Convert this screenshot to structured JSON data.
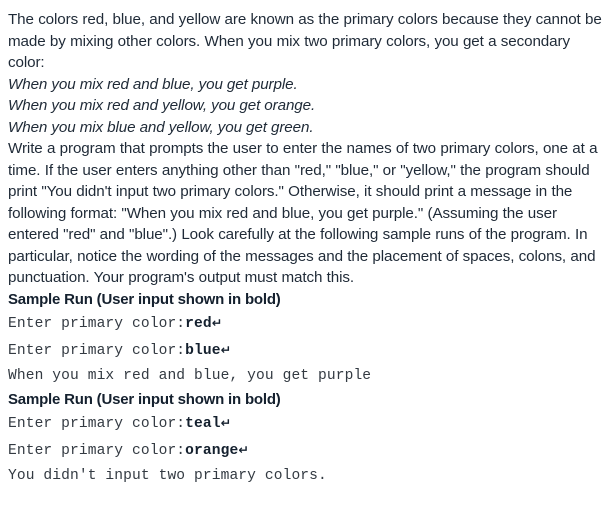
{
  "document": {
    "intro_paragraph": "The colors red, blue, and yellow are known as the primary colors because they cannot be made by mixing other colors. When you mix two primary colors, you get a secondary color:",
    "examples": [
      "When you mix red and blue, you get purple.",
      "When you mix red and yellow, you get orange.",
      "When you mix blue and yellow, you get green."
    ],
    "instructions_paragraph": "Write a program that prompts the user to enter the names of two primary colors, one at a time. If the user enters anything other than \"red,\" \"blue,\" or \"yellow,\" the program should print \"You didn't input two primary colors.\" Otherwise, it should print a message in the following format: \"When you mix red and blue, you get purple.\" (Assuming the user entered \"red\" and \"blue\".) Look carefully at the following sample runs of the program. In particular, notice the wording of the messages and the placement of spaces, colons, and punctuation. Your program's output must match this.",
    "sample_runs": [
      {
        "heading": "Sample Run (User input shown in bold)",
        "lines": [
          {
            "prompt": "Enter primary color:",
            "input": "red",
            "return_symbol": "↵"
          },
          {
            "prompt": "Enter primary color:",
            "input": "blue",
            "return_symbol": "↵"
          },
          {
            "prompt": "When you mix red and blue, you get purple",
            "input": "",
            "return_symbol": ""
          }
        ]
      },
      {
        "heading": "Sample Run (User input shown in bold)",
        "lines": [
          {
            "prompt": "Enter primary color:",
            "input": "teal",
            "return_symbol": "↵"
          },
          {
            "prompt": "Enter primary color:",
            "input": "orange",
            "return_symbol": "↵"
          },
          {
            "prompt": "You didn't input two primary colors.",
            "input": "",
            "return_symbol": ""
          }
        ]
      }
    ]
  }
}
